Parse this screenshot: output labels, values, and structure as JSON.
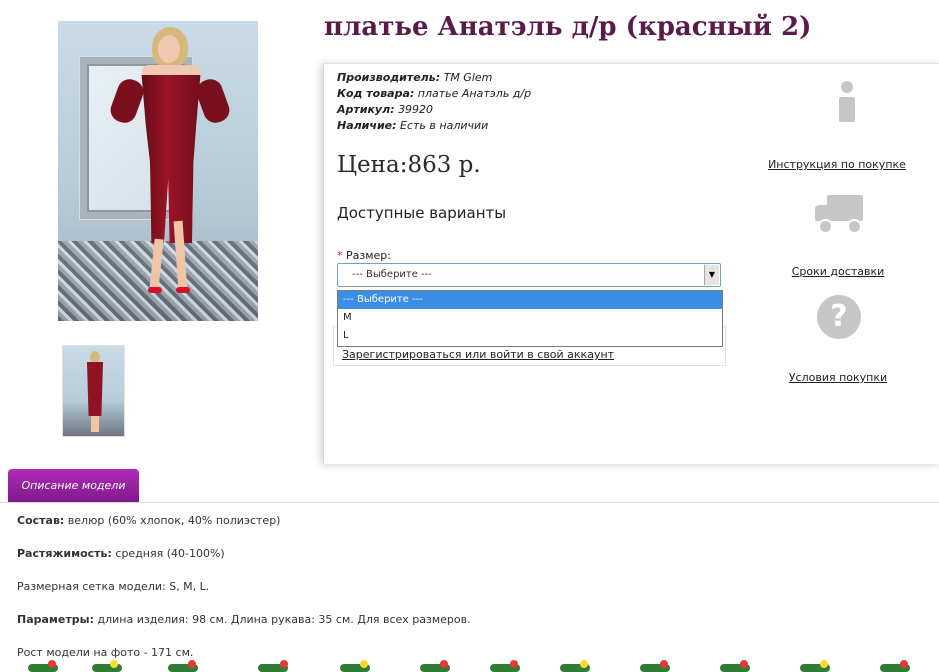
{
  "product": {
    "title": "платье Анатэль д/р (красный 2)",
    "meta": [
      {
        "label": "Производитель:",
        "value": "TM Glem"
      },
      {
        "label": "Код товара:",
        "value": "платье Анатэль д/р"
      },
      {
        "label": "Артикул:",
        "value": "39920"
      },
      {
        "label": "Наличие:",
        "value": "Есть в наличии"
      }
    ],
    "price": "Цена:863 р.",
    "variants_heading": "Доступные варианты",
    "size_label": "Размер:",
    "size_required_mark": "*",
    "select_value": "--- Выберите ---",
    "dropdown_options": [
      "--- Выберите ---",
      "M",
      "L"
    ],
    "login_link": "Зарегистрироваться или войти в свой аккаунт"
  },
  "sidebar": {
    "items": [
      {
        "icon": "info-icon",
        "label": "Инструкция по покупке"
      },
      {
        "icon": "truck-icon",
        "label": "Сроки доставки"
      },
      {
        "icon": "question-icon",
        "label": "Условия покупки"
      }
    ]
  },
  "tabs": {
    "active": "Описание модели"
  },
  "description": {
    "lines": [
      {
        "label": "Состав:",
        "value": " велюр (60% хлопок, 40% полиэстер)"
      },
      {
        "label": "Растяжимость:",
        "value": " средняя (40-100%)"
      },
      {
        "label": "",
        "value": "Размерная сетка модели: S, M, L."
      },
      {
        "label": "Параметры:",
        "value": " длина изделия: 98 см. Длина рукава: 35 см. Для всех размеров."
      },
      {
        "label": "",
        "value": "Рост модели на фото - 171 см."
      }
    ]
  },
  "colors": {
    "title": "#5a1a4a",
    "tab": "#9b23a4",
    "selected_option": "#3a8ee6",
    "icon_gray": "#c6c6c6"
  }
}
